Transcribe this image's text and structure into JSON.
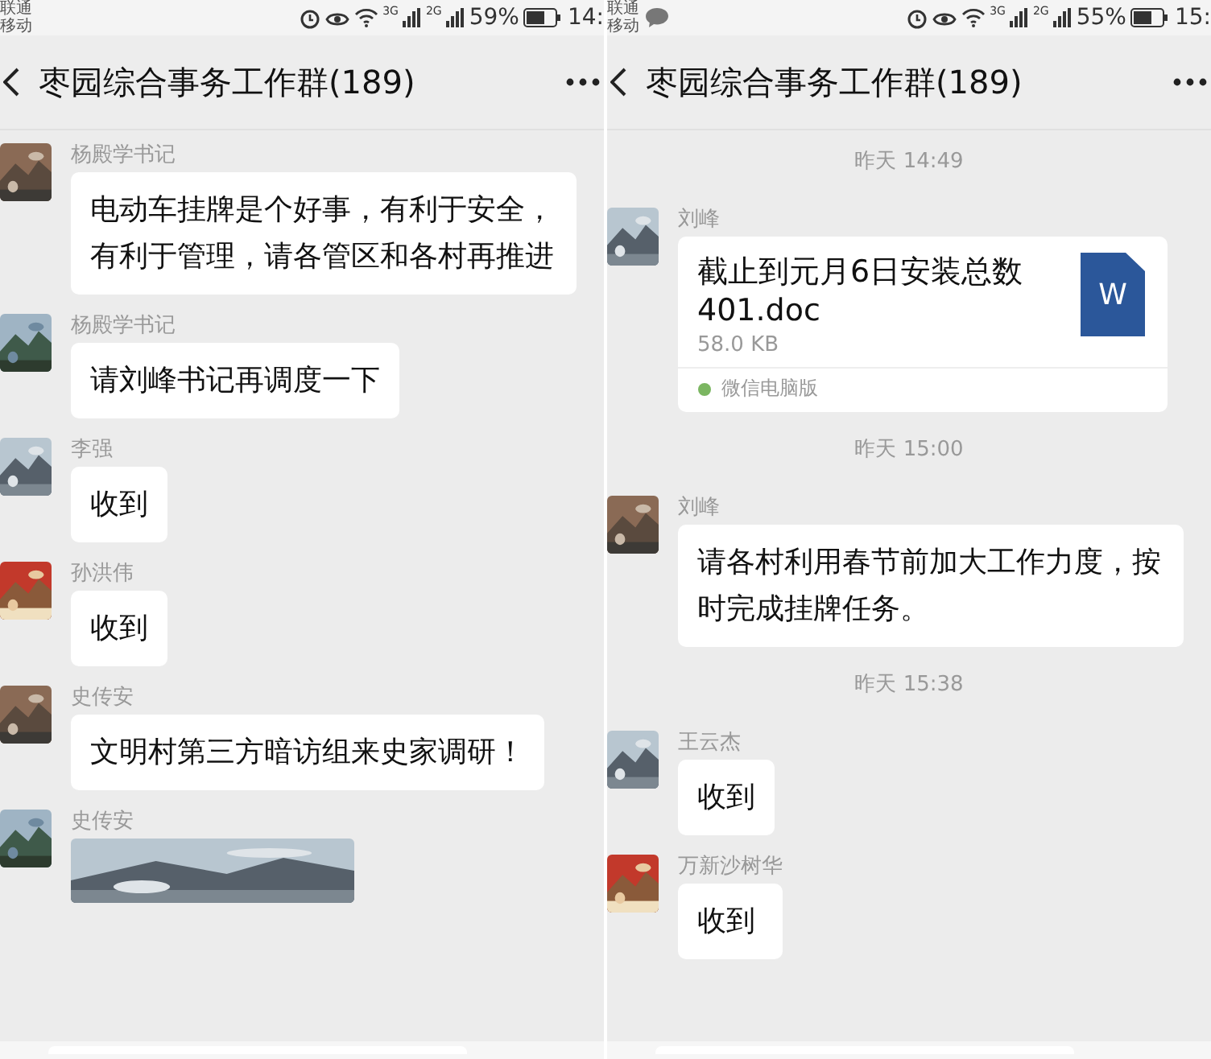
{
  "panels": [
    {
      "status_bar": {
        "carriers": [
          "联通",
          "移动"
        ],
        "chat_notification": false,
        "networks": [
          "3G",
          "2G"
        ],
        "battery": "59%",
        "time": "14:"
      },
      "title": "枣园综合事务工作群(189)",
      "messages": [
        {
          "kind": "text",
          "sender": "杨殿学书记",
          "text": "电动车挂牌是个好事，有利于安全，有利于管理，请各管区和各村再推进"
        },
        {
          "kind": "text",
          "sender": "杨殿学书记",
          "text": "请刘峰书记再调度一下"
        },
        {
          "kind": "text",
          "sender": "李强",
          "text": "收到"
        },
        {
          "kind": "text",
          "sender": "孙洪伟",
          "text": "收到"
        },
        {
          "kind": "text",
          "sender": "史传安",
          "text": "文明村第三方暗访组来史家调研！"
        },
        {
          "sender": "史传安"
        }
      ]
    },
    {
      "status_bar": {
        "carriers": [
          "联通",
          "移动"
        ],
        "chat_notification": true,
        "networks": [
          "3G",
          "2G"
        ],
        "battery": "55%",
        "time": "15:"
      },
      "title": "枣园综合事务工作群(189)",
      "messages": [
        {
          "kind": "time",
          "text": "昨天 14:49"
        },
        {
          "kind": "file",
          "sender": "刘峰",
          "file_name": "截止到元月6日安装总数401.doc",
          "size": "58.0 KB",
          "icon_letter": "W",
          "source": "微信电脑版"
        },
        {
          "kind": "time",
          "text": "昨天 15:00"
        },
        {
          "kind": "text",
          "sender": "刘峰",
          "text": "请各村利用春节前加大工作力度，按时完成挂牌任务。"
        },
        {
          "kind": "time",
          "text": "昨天 15:38"
        },
        {
          "kind": "text",
          "sender": "王云杰",
          "text": "收到"
        },
        {
          "kind": "text",
          "sender": "万新沙树华",
          "text": "收到"
        }
      ]
    }
  ]
}
